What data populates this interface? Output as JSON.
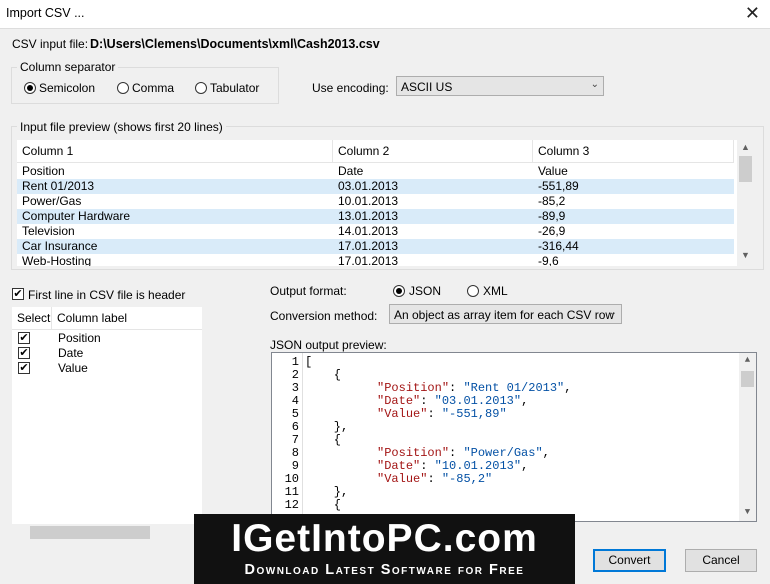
{
  "window": {
    "title": "Import CSV ...",
    "close_glyph": "✕"
  },
  "input_file": {
    "label": "CSV input file:",
    "path": "D:\\Users\\Clemens\\Documents\\xml\\Cash2013.csv"
  },
  "separator": {
    "legend": "Column separator",
    "options": [
      {
        "label": "Semicolon",
        "selected": true
      },
      {
        "label": "Comma",
        "selected": false
      },
      {
        "label": "Tabulator",
        "selected": false
      }
    ]
  },
  "encoding": {
    "label": "Use encoding:",
    "value": "ASCII US"
  },
  "preview": {
    "legend": "Input file preview (shows first 20 lines)",
    "columns": [
      "Column 1",
      "Column 2",
      "Column 3"
    ],
    "rows": [
      [
        "Position",
        "Date",
        "Value"
      ],
      [
        "Rent 01/2013",
        "03.01.2013",
        "-551,89"
      ],
      [
        "Power/Gas",
        "10.01.2013",
        "-85,2"
      ],
      [
        "Computer Hardware",
        "13.01.2013",
        "-89,9"
      ],
      [
        "Television",
        "14.01.2013",
        "-26,9"
      ],
      [
        "Car Insurance",
        "17.01.2013",
        "-316,44"
      ],
      [
        "Web-Hosting",
        "17.01.2013",
        "-9,6"
      ]
    ]
  },
  "header_option": {
    "label": "First line in CSV file is header",
    "checked": true
  },
  "column_list": {
    "headers": [
      "Select",
      "Column label"
    ],
    "items": [
      {
        "label": "Position",
        "checked": true
      },
      {
        "label": "Date",
        "checked": true
      },
      {
        "label": "Value",
        "checked": true
      }
    ]
  },
  "output_format": {
    "label": "Output format:",
    "options": [
      {
        "label": "JSON",
        "selected": true
      },
      {
        "label": "XML",
        "selected": false
      }
    ]
  },
  "conversion": {
    "label": "Conversion method:",
    "value": "An object as array item for each CSV row"
  },
  "json_preview": {
    "label": "JSON output preview:",
    "lines": [
      {
        "n": "1",
        "text": "["
      },
      {
        "n": "2",
        "text": "    {"
      },
      {
        "n": "3",
        "key": "\"Position\"",
        "val": "\"Rent 01/2013\"",
        "tail": ","
      },
      {
        "n": "4",
        "key": "\"Date\"",
        "val": "\"03.01.2013\"",
        "tail": ","
      },
      {
        "n": "5",
        "key": "\"Value\"",
        "val": "\"-551,89\"",
        "tail": ""
      },
      {
        "n": "6",
        "text": "    },"
      },
      {
        "n": "7",
        "text": "    {"
      },
      {
        "n": "8",
        "key": "\"Position\"",
        "val": "\"Power/Gas\"",
        "tail": ","
      },
      {
        "n": "9",
        "key": "\"Date\"",
        "val": "\"10.01.2013\"",
        "tail": ","
      },
      {
        "n": "10",
        "key": "\"Value\"",
        "val": "\"-85,2\"",
        "tail": ""
      },
      {
        "n": "11",
        "text": "    },"
      },
      {
        "n": "12",
        "text": "    {"
      }
    ]
  },
  "buttons": {
    "convert": "Convert",
    "cancel": "Cancel"
  },
  "watermark": {
    "brand": "IGetIntoPC.com",
    "tagline": "Download Latest Software for Free"
  },
  "icons": {
    "check": "✔",
    "arrow_up": "▲",
    "arrow_down": "▼",
    "combo_arrow": "⌄"
  }
}
